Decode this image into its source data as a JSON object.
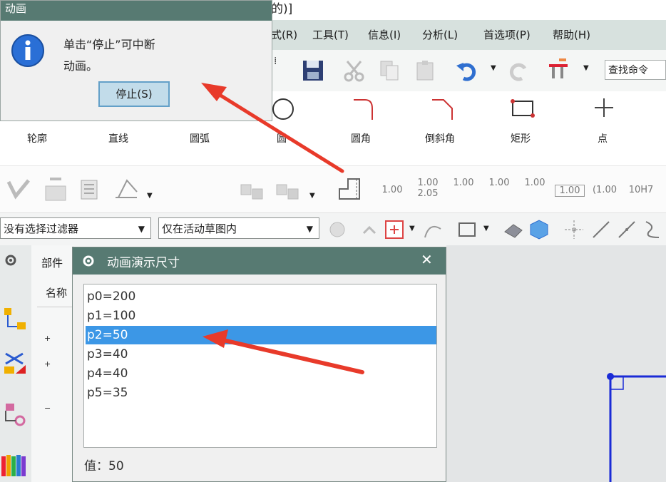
{
  "window_title_fragment": "的)]",
  "menu": [
    "式(R)",
    "工具(T)",
    "信息(I)",
    "分析(L)",
    "首选项(P)",
    "帮助(H)"
  ],
  "toolbar": {
    "find_command": "查找命令"
  },
  "sketch_ribbon": [
    "轮廓",
    "直线",
    "圆弧",
    "圆",
    "圆角",
    "倒斜角",
    "矩形",
    "点"
  ],
  "dims": [
    "1.00",
    "1.00\n2.05",
    "1.00",
    "1.00",
    "1.00",
    "1.00",
    "(1.00",
    "10H7"
  ],
  "filters": {
    "selection_filter": "没有选择过滤器",
    "scope": "仅在活动草图内"
  },
  "nav": {
    "tab": "部件",
    "col_name": "名称"
  },
  "anim_dialog": {
    "title": "动画演示尺寸",
    "close": "✕",
    "items": [
      "p0=200",
      "p1=100",
      "p2=50",
      "p3=40",
      "p4=40",
      "p5=35"
    ],
    "selected_index": 2,
    "value_label": "值：50"
  },
  "stop_dialog": {
    "title": "动画",
    "message_line1": "单击“停止”可中断",
    "message_line2": "动画。",
    "stop_button": "停止(S)"
  },
  "colors": {
    "dialog_title": "#577a72",
    "selection": "#3c97e6",
    "arrow": "#e83a2a",
    "sketch_line": "#1a2bd6"
  }
}
